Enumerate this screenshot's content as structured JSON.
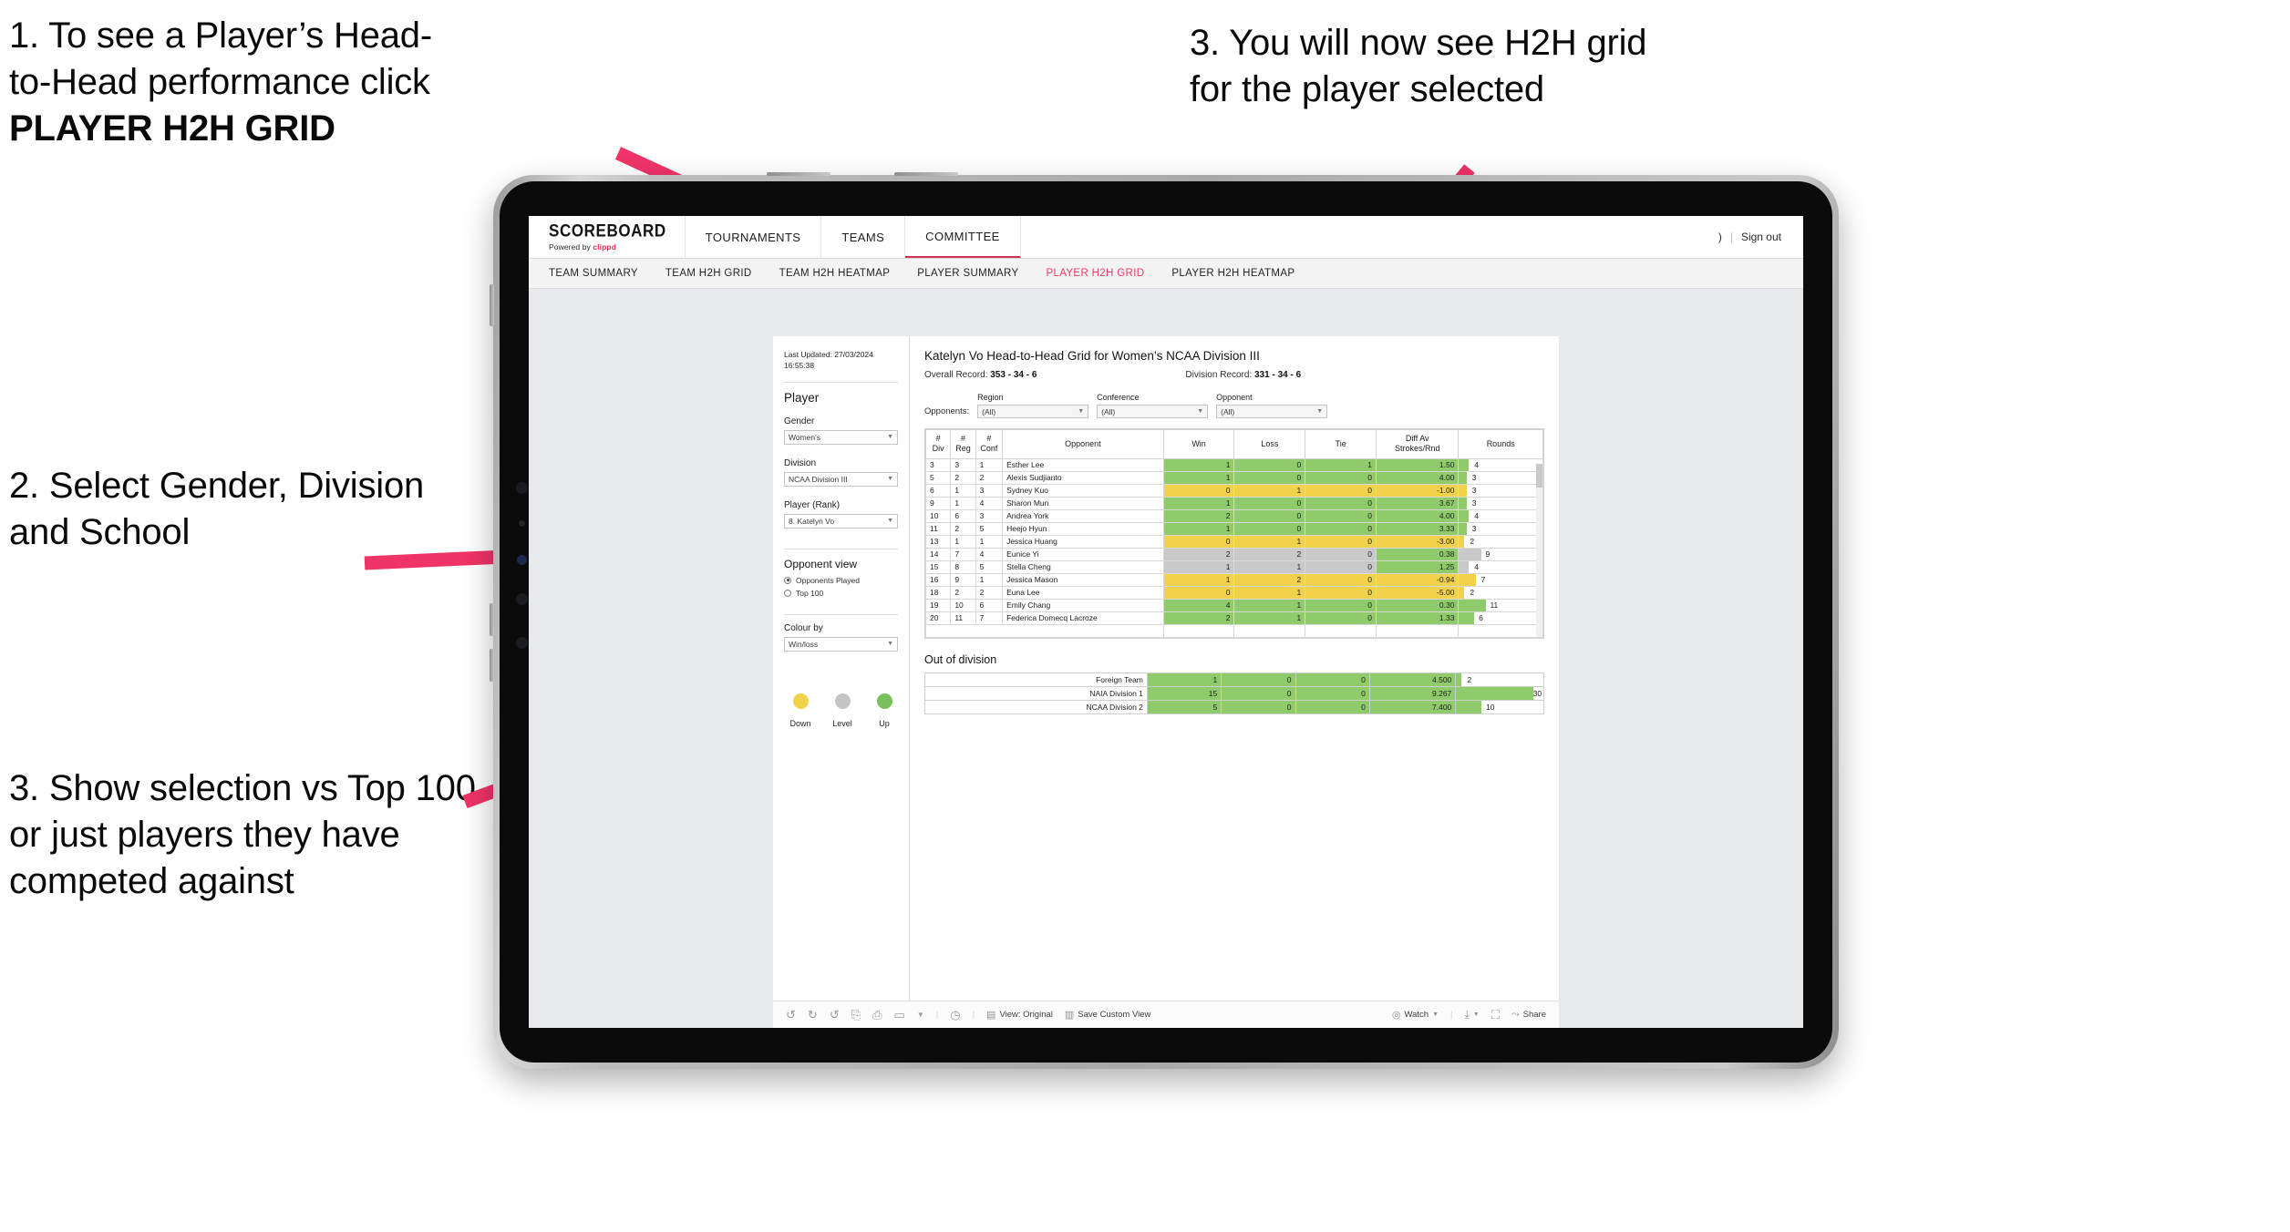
{
  "annotations": {
    "step1_line1": "1. To see a Player’s Head-",
    "step1_line2": "to-Head performance click",
    "step1_bold": "PLAYER H2H GRID",
    "step2": "2. Select Gender, Division and School",
    "step3": "3. Show selection vs Top 100 or just players they have competed against",
    "step4_line1": "3. You will now see H2H grid",
    "step4_line2": "for the player selected"
  },
  "colors": {
    "arrow": "#ef3467",
    "accent": "#ef3b63",
    "green": "#8fcb6b",
    "yellow": "#f2d24b",
    "grey": "#c9c9c9",
    "greenBar": "#90cc6e"
  },
  "browser": {
    "brand": {
      "name": "SCOREBOARD",
      "sub_prefix": "Powered by ",
      "sub_brand": "clippd"
    },
    "topnav": [
      {
        "label": "TOURNAMENTS",
        "active": false
      },
      {
        "label": "TEAMS",
        "active": false
      },
      {
        "label": "COMMITTEE",
        "active": true
      }
    ],
    "account": {
      "user_glyph": ")",
      "divider": "|",
      "signout": "Sign out"
    },
    "subnav": [
      {
        "label": "TEAM SUMMARY",
        "active": false
      },
      {
        "label": "TEAM H2H GRID",
        "active": false
      },
      {
        "label": "TEAM H2H HEATMAP",
        "active": false
      },
      {
        "label": "PLAYER SUMMARY",
        "active": false
      },
      {
        "label": "PLAYER H2H GRID",
        "active": true
      },
      {
        "label": "PLAYER H2H HEATMAP",
        "active": false
      }
    ]
  },
  "sidebar": {
    "last_updated": "Last Updated: 27/03/2024 16:55:38",
    "section_player": "Player",
    "gender": {
      "label": "Gender",
      "value": "Women's"
    },
    "division": {
      "label": "Division",
      "value": "NCAA Division III"
    },
    "player_rank": {
      "label": "Player (Rank)",
      "value": "8. Katelyn Vo"
    },
    "opponent_view": {
      "title": "Opponent view",
      "options": [
        {
          "label": "Opponents Played",
          "selected": true
        },
        {
          "label": "Top 100",
          "selected": false
        }
      ]
    },
    "colour_by": {
      "label": "Colour by",
      "value": "Win/loss"
    },
    "legend": [
      {
        "label": "Down",
        "color": "#f2d24b"
      },
      {
        "label": "Level",
        "color": "#c5c5c5"
      },
      {
        "label": "Up",
        "color": "#78c05a"
      }
    ]
  },
  "main": {
    "title": "Katelyn Vo Head-to-Head Grid for Women’s NCAA Division III",
    "overall_record_label": "Overall Record:",
    "overall_record_value": "353 - 34 - 6",
    "division_record_label": "Division Record:",
    "division_record_value": "331 - 34 - 6",
    "opponents_label": "Opponents:",
    "filters": [
      {
        "label": "Region",
        "value": "(All)"
      },
      {
        "label": "Conference",
        "value": "(All)"
      },
      {
        "label": "Opponent",
        "value": "(All)"
      }
    ],
    "table_headers": {
      "div": "#\nDiv",
      "reg": "#\nReg",
      "conf": "#\nConf",
      "opponent": "Opponent",
      "win": "Win",
      "loss": "Loss",
      "tie": "Tie",
      "diff": "Diff Av\nStrokes/Rnd",
      "rounds": "Rounds"
    },
    "out_of_division_title": "Out of division"
  },
  "toolbar": {
    "view_label": "View: Original",
    "save_label": "Save Custom View",
    "watch_label": "Watch",
    "share_label": "Share"
  },
  "chart_data": {
    "type": "table",
    "title": "Katelyn Vo Head-to-Head Grid for Women’s NCAA Division III",
    "columns": [
      "# Div",
      "# Reg",
      "# Conf",
      "Opponent",
      "Win",
      "Loss",
      "Tie",
      "Diff Av Strokes/Rnd",
      "Rounds"
    ],
    "rounds_max": 34,
    "rows": [
      {
        "div": "3",
        "reg": "3",
        "conf": "1",
        "opponent": "Esther Lee",
        "win": "1",
        "loss": "0",
        "tie": "1",
        "diff": "1.50",
        "rounds": "4",
        "state": "up"
      },
      {
        "div": "5",
        "reg": "2",
        "conf": "2",
        "opponent": "Alexis Sudjianto",
        "win": "1",
        "loss": "0",
        "tie": "0",
        "diff": "4.00",
        "rounds": "3",
        "state": "up"
      },
      {
        "div": "6",
        "reg": "1",
        "conf": "3",
        "opponent": "Sydney Kuo",
        "win": "0",
        "loss": "1",
        "tie": "0",
        "diff": "-1.00",
        "rounds": "3",
        "state": "down"
      },
      {
        "div": "9",
        "reg": "1",
        "conf": "4",
        "opponent": "Sharon Mun",
        "win": "1",
        "loss": "0",
        "tie": "0",
        "diff": "3.67",
        "rounds": "3",
        "state": "up"
      },
      {
        "div": "10",
        "reg": "6",
        "conf": "3",
        "opponent": "Andrea York",
        "win": "2",
        "loss": "0",
        "tie": "0",
        "diff": "4.00",
        "rounds": "4",
        "state": "up"
      },
      {
        "div": "11",
        "reg": "2",
        "conf": "5",
        "opponent": "Heejo Hyun",
        "win": "1",
        "loss": "0",
        "tie": "0",
        "diff": "3.33",
        "rounds": "3",
        "state": "up"
      },
      {
        "div": "13",
        "reg": "1",
        "conf": "1",
        "opponent": "Jessica Huang",
        "win": "0",
        "loss": "1",
        "tie": "0",
        "diff": "-3.00",
        "rounds": "2",
        "state": "down"
      },
      {
        "div": "14",
        "reg": "7",
        "conf": "4",
        "opponent": "Eunice Yi",
        "win": "2",
        "loss": "2",
        "tie": "0",
        "diff": "0.38",
        "rounds": "9",
        "state": "level"
      },
      {
        "div": "15",
        "reg": "8",
        "conf": "5",
        "opponent": "Stella Cheng",
        "win": "1",
        "loss": "1",
        "tie": "0",
        "diff": "1.25",
        "rounds": "4",
        "state": "level"
      },
      {
        "div": "16",
        "reg": "9",
        "conf": "1",
        "opponent": "Jessica Mason",
        "win": "1",
        "loss": "2",
        "tie": "0",
        "diff": "-0.94",
        "rounds": "7",
        "state": "down"
      },
      {
        "div": "18",
        "reg": "2",
        "conf": "2",
        "opponent": "Euna Lee",
        "win": "0",
        "loss": "1",
        "tie": "0",
        "diff": "-5.00",
        "rounds": "2",
        "state": "down"
      },
      {
        "div": "19",
        "reg": "10",
        "conf": "6",
        "opponent": "Emily Chang",
        "win": "4",
        "loss": "1",
        "tie": "0",
        "diff": "0.30",
        "rounds": "11",
        "state": "up"
      },
      {
        "div": "20",
        "reg": "11",
        "conf": "7",
        "opponent": "Federica Domecq Lacroze",
        "win": "2",
        "loss": "1",
        "tie": "0",
        "diff": "1.33",
        "rounds": "6",
        "state": "up"
      }
    ],
    "out_of_division": {
      "rounds_max": 34,
      "rows": [
        {
          "opponent": "Foreign Team",
          "win": "1",
          "loss": "0",
          "tie": "0",
          "diff": "4.500",
          "rounds": "2",
          "state": "up"
        },
        {
          "opponent": "NAIA Division 1",
          "win": "15",
          "loss": "0",
          "tie": "0",
          "diff": "9.267",
          "rounds": "30",
          "state": "up"
        },
        {
          "opponent": "NCAA Division 2",
          "win": "5",
          "loss": "0",
          "tie": "0",
          "diff": "7.400",
          "rounds": "10",
          "state": "up"
        }
      ]
    }
  }
}
